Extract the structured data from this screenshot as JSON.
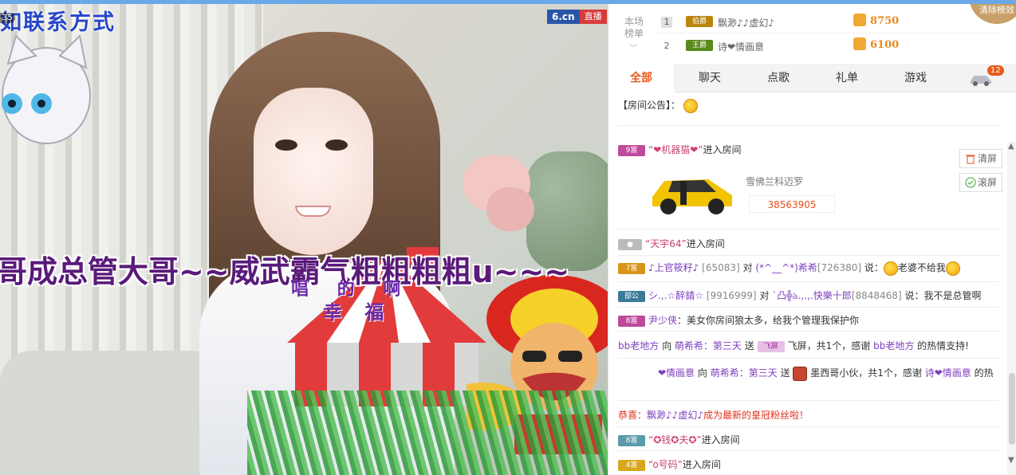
{
  "video": {
    "contact_text": "如联系方式",
    "viewer_count": "35",
    "logo_text": "6.cn",
    "live_badge": "直播",
    "scroll_text": "哥成总管大哥~~威武霸气粗粗粗粗u~~~",
    "sing_text": "唱 的 啊",
    "happy_text": "幸 福"
  },
  "rank": {
    "title_line1": "本场",
    "title_line2": "榜单",
    "rows": [
      {
        "num": "1",
        "badge": "伯爵",
        "badge_color": "#b8860b",
        "name": "飘渺♪♪虚幻♪",
        "score": "8750"
      },
      {
        "num": "2",
        "badge": "王爵",
        "badge_color": "#5a8a1a",
        "name": "诗❤情画意",
        "score": "6100"
      }
    ],
    "corner_label": "清除榜效"
  },
  "tabs": [
    "全部",
    "聊天",
    "点歌",
    "礼单",
    "游戏"
  ],
  "car_badge_count": "12",
  "chat": {
    "announcement_label": "【房间公告】：",
    "tools": {
      "clear": "清屏",
      "scroll": "滚屏"
    },
    "msg1": {
      "badge": "9富",
      "name": "“❤机器猫❤”",
      "text": "进入房间"
    },
    "car": {
      "name": "雪佛兰科迈罗",
      "number": "38563905"
    },
    "msg2": {
      "name": "“天宇64”",
      "text": "进入房间"
    },
    "msg3": {
      "badge": "7富",
      "from": "♪上官筱籽♪",
      "from_id": "[65083]",
      "to_word": "对",
      "to": "(*^__^*)希希",
      "to_id": "[726380]",
      "say": "说：",
      "text": "老婆不给我"
    },
    "msg4": {
      "badge": "部公",
      "from": "シ.,.☆醉錆☆",
      "from_id": "[9916999]",
      "to_word": "对",
      "to": "ˋ凸╬ঌ.,.,.快樂十郎",
      "to_id": "[8848468]",
      "say": "说：",
      "text": "我不是总管啊"
    },
    "msg5": {
      "badge": "8富",
      "from": "尹少侠",
      "text": "：美女你房间狼太多，给我个管理我保护你"
    },
    "msg6": {
      "from": "bb老地方",
      "to_word": "向",
      "to": "萌希希：第三天",
      "send": "送",
      "gift_icon": "飞屏",
      "tail": "飞屏，共1个，感谢",
      "thanks_name": "bb老地方",
      "end": "的热情支持!"
    },
    "msg7": {
      "from": "❤情画意",
      "to_word": "向",
      "to": "萌希希：第三天",
      "send": "送",
      "gift": "墨西哥小伙，共1个，感谢",
      "thanks_name": "诗❤情画意",
      "end": "的热"
    },
    "msg8": {
      "prefix": "恭喜：",
      "name": "飘渺♪♪虚幻♪",
      "text": "成为最新的皇冠粉丝啦！"
    },
    "msg9": {
      "badge": "8富",
      "name": "“✪钱✪夫✪”",
      "text": "进入房间"
    },
    "msg10": {
      "badge": "4富",
      "name": "“o号码”",
      "text": "进入房间"
    }
  }
}
